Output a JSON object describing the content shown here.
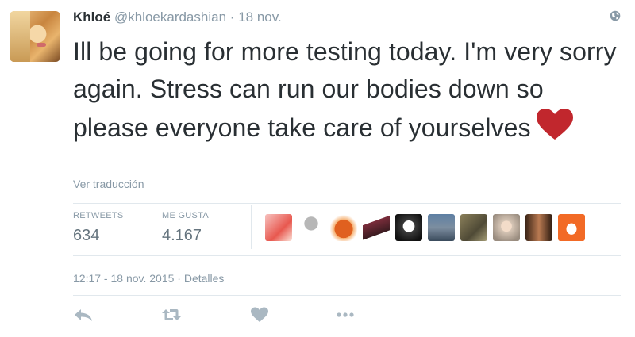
{
  "tweet": {
    "author_name": "Khloé",
    "author_handle": "@khloekardashian",
    "separator": "·",
    "date": "18 nov.",
    "text": "Ill be going for more testing today. I'm very sorry again. Stress can run our bodies down so please everyone take care of yourselves",
    "emoji": "red-heart",
    "translate_label": "Ver traducción",
    "stats": {
      "retweets_label": "RETWEETS",
      "retweets_value": "634",
      "likes_label": "ME GUSTA",
      "likes_value": "4.167"
    },
    "timestamp": "12:17 - 18 nov. 2015 · Detalles",
    "likers_count": 10
  },
  "colors": {
    "text": "#292f33",
    "muted": "#8899a6",
    "stat_value": "#66757f",
    "divider": "#e1e8ed",
    "heart": "#c1272d",
    "action_icon": "#aab8c2"
  },
  "icons": {
    "globe": "globe-icon",
    "reply": "reply-icon",
    "retweet": "retweet-icon",
    "like": "heart-icon",
    "more": "more-icon"
  }
}
